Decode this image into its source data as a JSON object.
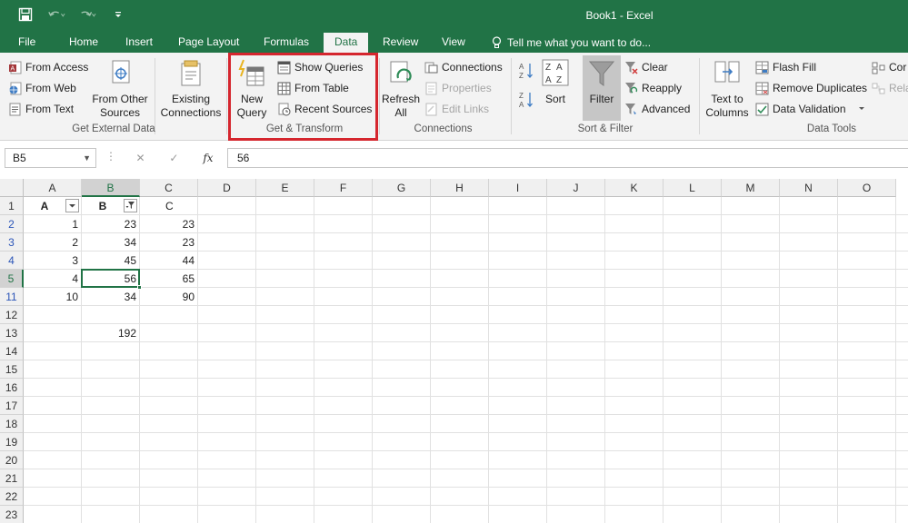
{
  "window": {
    "title": "Book1 - Excel"
  },
  "tabs": [
    {
      "label": "File"
    },
    {
      "label": "Home"
    },
    {
      "label": "Insert"
    },
    {
      "label": "Page Layout"
    },
    {
      "label": "Formulas"
    },
    {
      "label": "Data"
    },
    {
      "label": "Review"
    },
    {
      "label": "View"
    }
  ],
  "tell_me": "Tell me what you want to do...",
  "ribbon": {
    "get_external_data": {
      "label": "Get External Data",
      "from_access": "From Access",
      "from_web": "From Web",
      "from_text": "From Text",
      "from_other_sources_1": "From Other",
      "from_other_sources_2": "Sources",
      "existing_connections_1": "Existing",
      "existing_connections_2": "Connections"
    },
    "get_transform": {
      "label": "Get & Transform",
      "new_query_1": "New",
      "new_query_2": "Query",
      "show_queries": "Show Queries",
      "from_table": "From Table",
      "recent_sources": "Recent Sources"
    },
    "connections": {
      "label": "Connections",
      "refresh_all_1": "Refresh",
      "refresh_all_2": "All",
      "connections": "Connections",
      "properties": "Properties",
      "edit_links": "Edit Links"
    },
    "sort_filter": {
      "label": "Sort & Filter",
      "sort": "Sort",
      "filter": "Filter",
      "clear": "Clear",
      "reapply": "Reapply",
      "advanced": "Advanced"
    },
    "data_tools": {
      "label": "Data Tools",
      "text_to_columns_1": "Text to",
      "text_to_columns_2": "Columns",
      "flash_fill": "Flash Fill",
      "remove_duplicates": "Remove Duplicates",
      "data_validation": "Data Validation",
      "consolidate": "Cor",
      "relationships": "Rela"
    }
  },
  "formula_bar": {
    "name_box": "B5",
    "value": "56",
    "fx": "fx"
  },
  "columns": [
    "A",
    "B",
    "C",
    "D",
    "E",
    "F",
    "G",
    "H",
    "I",
    "J",
    "K",
    "L",
    "M",
    "N",
    "O"
  ],
  "rows": [
    "1",
    "2",
    "3",
    "4",
    "5",
    "11",
    "12",
    "13",
    "14",
    "15",
    "16",
    "17",
    "18",
    "19",
    "20",
    "21",
    "22",
    "23"
  ],
  "cells": {
    "A1": "A",
    "B1": "B",
    "C1": "C",
    "A2": "1",
    "B2": "23",
    "C2": "23",
    "A3": "2",
    "B3": "34",
    "C3": "23",
    "A4": "3",
    "B4": "45",
    "C4": "44",
    "A5": "4",
    "B5": "56",
    "C5": "65",
    "A11": "10",
    "B11": "34",
    "C11": "90",
    "B13": "192"
  },
  "colors": {
    "accent": "#217346",
    "highlight": "#d5262e",
    "filtered_row": "#2b55b8"
  }
}
